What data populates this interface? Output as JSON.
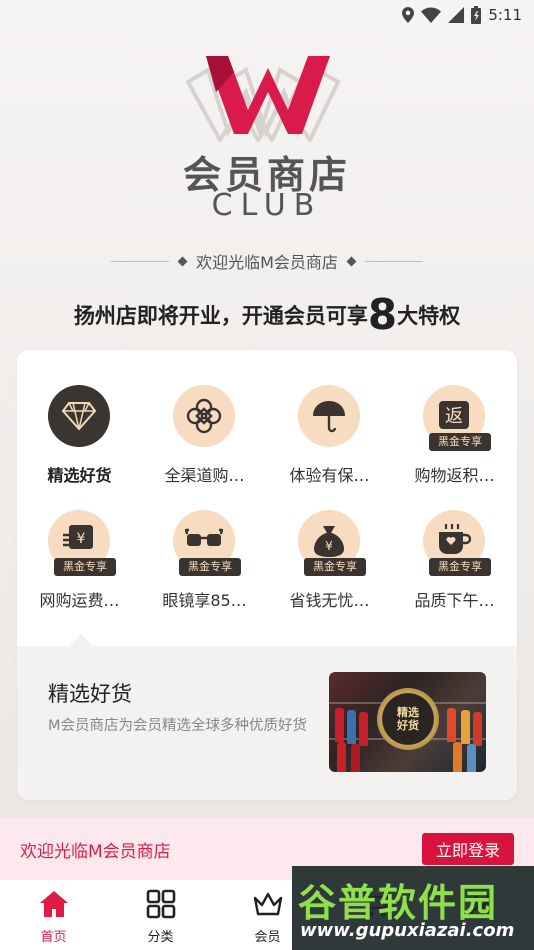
{
  "status_bar": {
    "time": "5:11"
  },
  "logo": {
    "title": "会员商店",
    "subtitle": "CLUB"
  },
  "welcome": "欢迎光临M会员商店",
  "headline": {
    "before": "扬州店即将开业，开通会员可享",
    "number": "8",
    "after": "大特权"
  },
  "privileges": [
    {
      "label": "精选好货",
      "icon": "diamond-icon",
      "badge": "",
      "selected": true
    },
    {
      "label": "全渠道购…",
      "icon": "flower-icon",
      "badge": "",
      "selected": false
    },
    {
      "label": "体验有保…",
      "icon": "umbrella-icon",
      "badge": "",
      "selected": false
    },
    {
      "label": "购物返积…",
      "icon": "rebate-icon",
      "badge": "黑金专享",
      "selected": false
    },
    {
      "label": "网购运费…",
      "icon": "shipping-icon",
      "badge": "黑金专享",
      "selected": false
    },
    {
      "label": "眼镜享85…",
      "icon": "glasses-icon",
      "badge": "黑金专享",
      "selected": false
    },
    {
      "label": "省钱无忧…",
      "icon": "money-bag-icon",
      "badge": "黑金专享",
      "selected": false
    },
    {
      "label": "品质下午…",
      "icon": "coffee-cup-icon",
      "badge": "黑金专享",
      "selected": false
    }
  ],
  "rebate_char": "返",
  "shipping_char": "¥",
  "money_char": "¥",
  "detail": {
    "title": "精选好货",
    "description": "M会员商店为会员精选全球多种优质好货",
    "seal_line1": "精选",
    "seal_line2": "好货"
  },
  "banner": {
    "text": "欢迎光临M会员商店",
    "button": "立即登录"
  },
  "tabs": [
    {
      "label": "首页",
      "icon": "home-icon",
      "active": true
    },
    {
      "label": "分类",
      "icon": "category-grid-icon",
      "active": false
    },
    {
      "label": "会员",
      "icon": "crown-icon",
      "active": false
    },
    {
      "label": "",
      "icon": "cart-icon",
      "active": false
    },
    {
      "label": "",
      "icon": "profile-icon",
      "active": false
    }
  ],
  "watermark": {
    "title": "谷普软件园",
    "url": "www.gupuxiazai.com"
  },
  "colors": {
    "brand_red": "#e01c46",
    "gold": "#f8dcc1",
    "dark": "#3a3330"
  }
}
